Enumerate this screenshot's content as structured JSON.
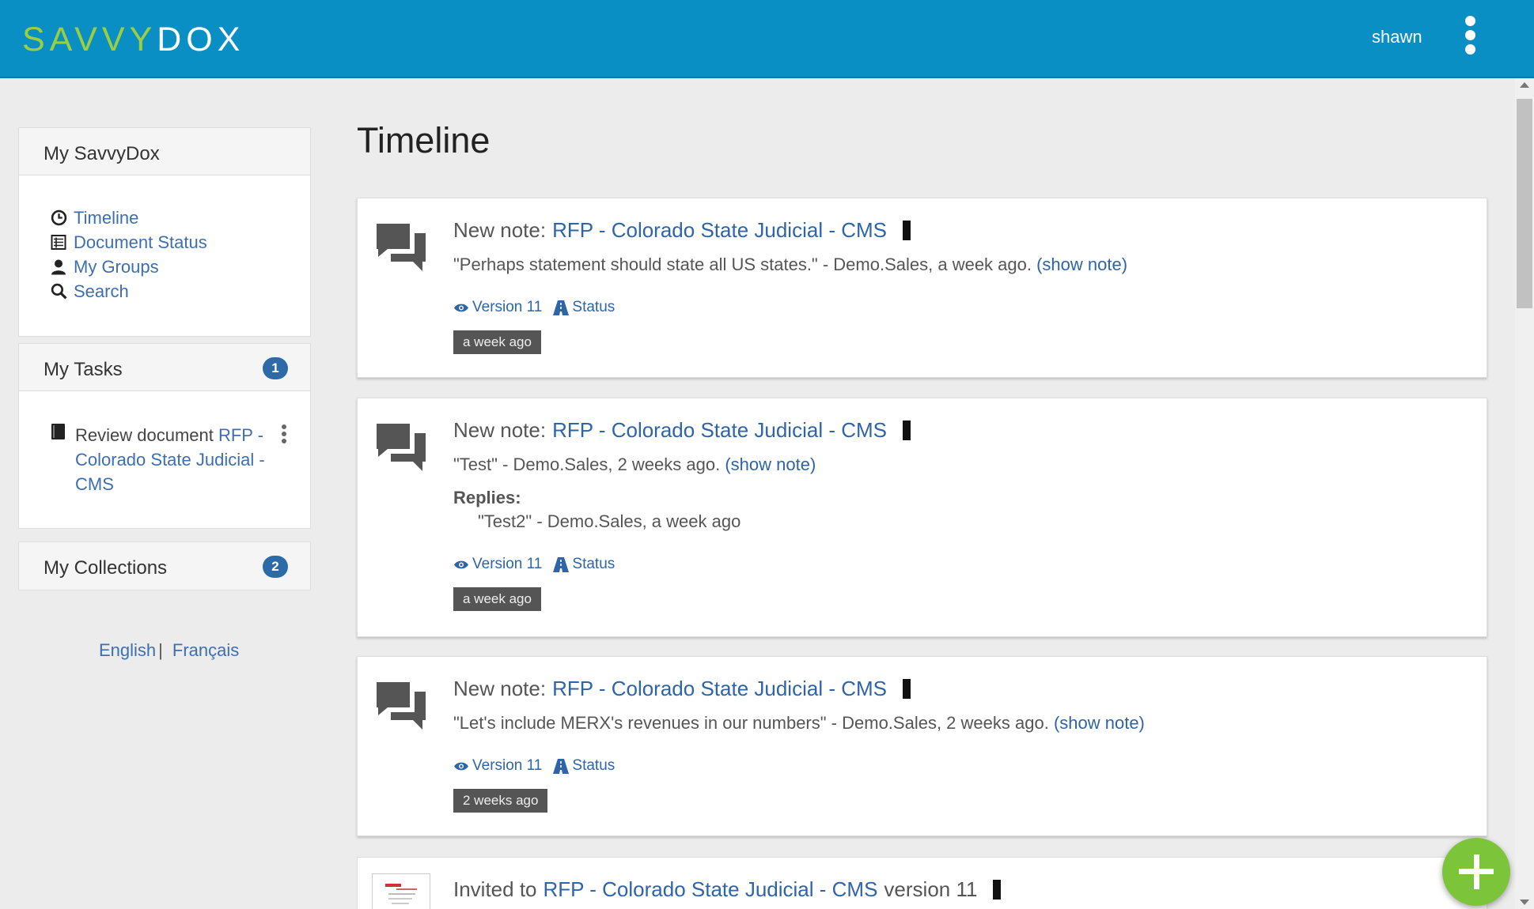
{
  "header": {
    "logo_part1": "SAVVY",
    "logo_part2": "DOX",
    "username": "shawn",
    "menu_icon": "kebab-vertical-icon"
  },
  "sidebar": {
    "my_savvydox": {
      "title": "My SavvyDox",
      "items": [
        {
          "label": "Timeline",
          "icon": "clock-icon"
        },
        {
          "label": "Document Status",
          "icon": "list-icon"
        },
        {
          "label": "My Groups",
          "icon": "user-icon"
        },
        {
          "label": "Search",
          "icon": "search-icon"
        }
      ]
    },
    "my_tasks": {
      "title": "My Tasks",
      "count": "1",
      "task": {
        "prefix": "Review document ",
        "link": "RFP - Colorado State Judicial - CMS"
      }
    },
    "my_collections": {
      "title": "My Collections",
      "count": "2"
    },
    "languages": {
      "english": "English",
      "separator": "|",
      "french": "Français"
    }
  },
  "main": {
    "title": "Timeline",
    "cards": [
      {
        "title_prefix": "New note:",
        "doc": "RFP - Colorado State Judicial - CMS",
        "quote": "\"Perhaps statement should state all US states.\" - Demo.Sales, a week ago.",
        "show_note": "(show note)",
        "version": "Version 11",
        "status": "Status",
        "time": "a week ago"
      },
      {
        "title_prefix": "New note:",
        "doc": "RFP - Colorado State Judicial - CMS",
        "quote": "\"Test\" - Demo.Sales, 2 weeks ago.",
        "show_note": "(show note)",
        "replies_label": "Replies:",
        "reply": "\"Test2\" - Demo.Sales, a week ago",
        "version": "Version 11",
        "status": "Status",
        "time": "a week ago"
      },
      {
        "title_prefix": "New note:",
        "doc": "RFP - Colorado State Judicial - CMS",
        "quote": "\"Let's include MERX's revenues in our numbers\" - Demo.Sales, 2 weeks ago.",
        "show_note": "(show note)",
        "version": "Version 11",
        "status": "Status",
        "time": "2 weeks ago"
      },
      {
        "title_prefix": "Invited to",
        "doc": "RFP - Colorado State Judicial - CMS",
        "suffix": "version 11"
      }
    ]
  },
  "colors": {
    "header": "#0a8fc5",
    "logo_green": "#9ccf3f",
    "link": "#2e64a8",
    "badge": "#2d6ba8",
    "fab": "#7cc53a"
  }
}
